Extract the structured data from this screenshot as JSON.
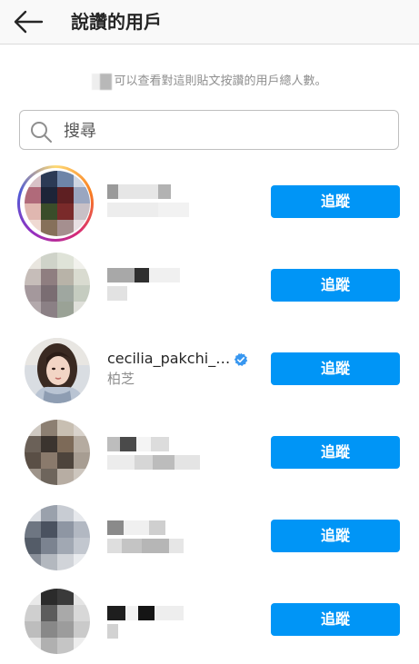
{
  "header": {
    "title": "說讚的用戶"
  },
  "info_text": "可以查看對這則貼文按讚的用戶總人數。",
  "search": {
    "placeholder": "搜尋"
  },
  "follow_label": "追蹤",
  "users": [
    {
      "username": "",
      "fullname": "",
      "blurred": true,
      "story_ring": true
    },
    {
      "username": "",
      "fullname": "",
      "blurred": true,
      "story_ring": false
    },
    {
      "username": "cecilia_pakchi_…",
      "fullname": "柏芝",
      "blurred": false,
      "verified": true,
      "story_ring": false
    },
    {
      "username": "",
      "fullname": "",
      "blurred": true,
      "story_ring": false
    },
    {
      "username": "",
      "fullname": "",
      "blurred": true,
      "story_ring": false
    },
    {
      "username": "",
      "fullname": "",
      "blurred": true,
      "story_ring": false
    }
  ],
  "icons": {
    "back": "arrow-left-icon",
    "search": "search-icon",
    "verified": "verified-badge-icon"
  },
  "colors": {
    "follow_button": "#0095f6",
    "verified": "#3897f0",
    "text_secondary": "#8e8e8e"
  }
}
